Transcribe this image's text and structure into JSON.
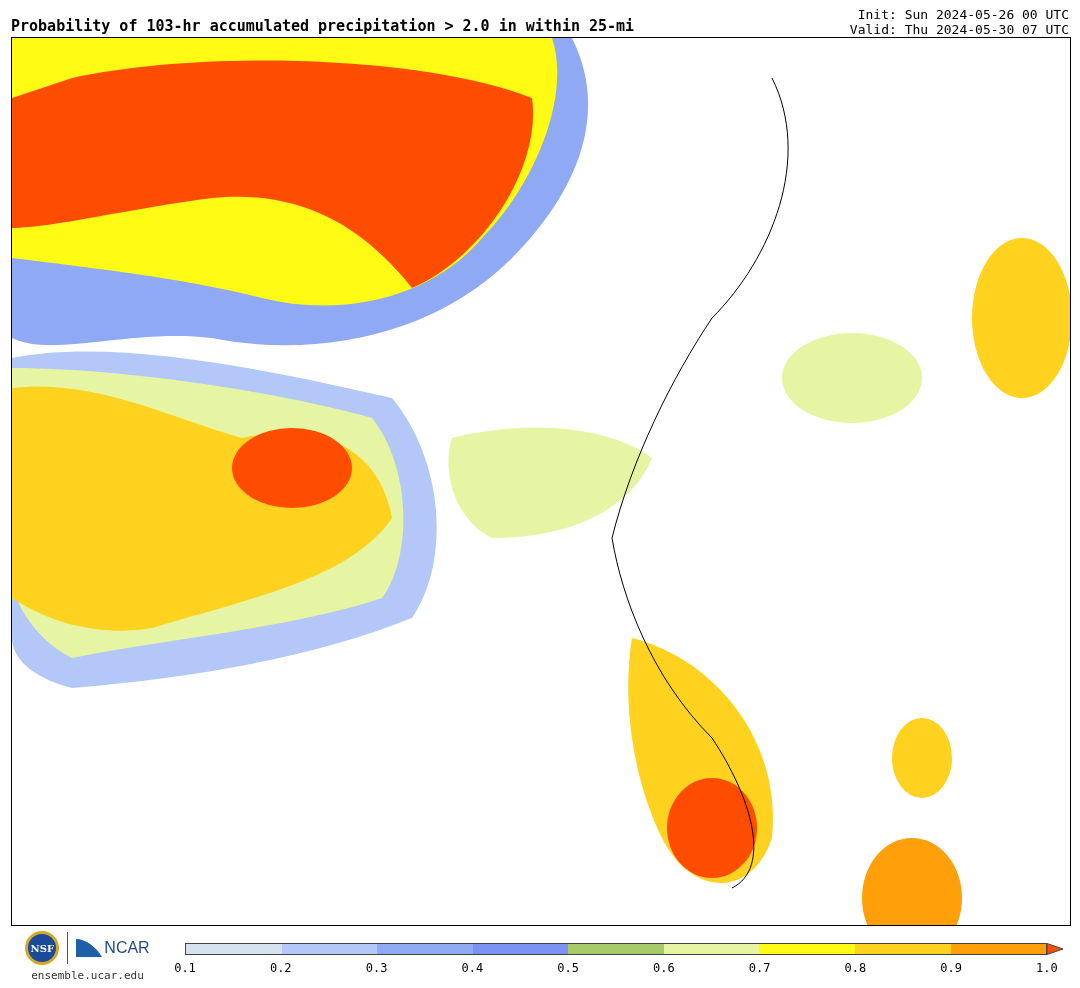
{
  "title": "Probability of 103-hr accumulated precipitation > 2.0 in within 25-mi",
  "init": "Init: Sun 2024-05-26 00 UTC",
  "valid": "Valid: Thu 2024-05-30 07 UTC",
  "logos": {
    "nsf": "NSF",
    "ncar": "NCAR",
    "url": "ensemble.ucar.edu"
  },
  "colorbar": {
    "segments": [
      {
        "color": "#d6e2ee"
      },
      {
        "color": "#b3c8f8"
      },
      {
        "color": "#8fa9f5"
      },
      {
        "color": "#7a93f2"
      },
      {
        "color": "#a6c96a"
      },
      {
        "color": "#e6f5a3"
      },
      {
        "color": "#fffb14"
      },
      {
        "color": "#ffd21f"
      },
      {
        "color": "#ff9f0a"
      }
    ],
    "over_arrow": {
      "color": "#ff4d00"
    },
    "ticks": [
      "0.1",
      "0.2",
      "0.3",
      "0.4",
      "0.5",
      "0.6",
      "0.7",
      "0.8",
      "0.9",
      "1.0"
    ]
  }
}
